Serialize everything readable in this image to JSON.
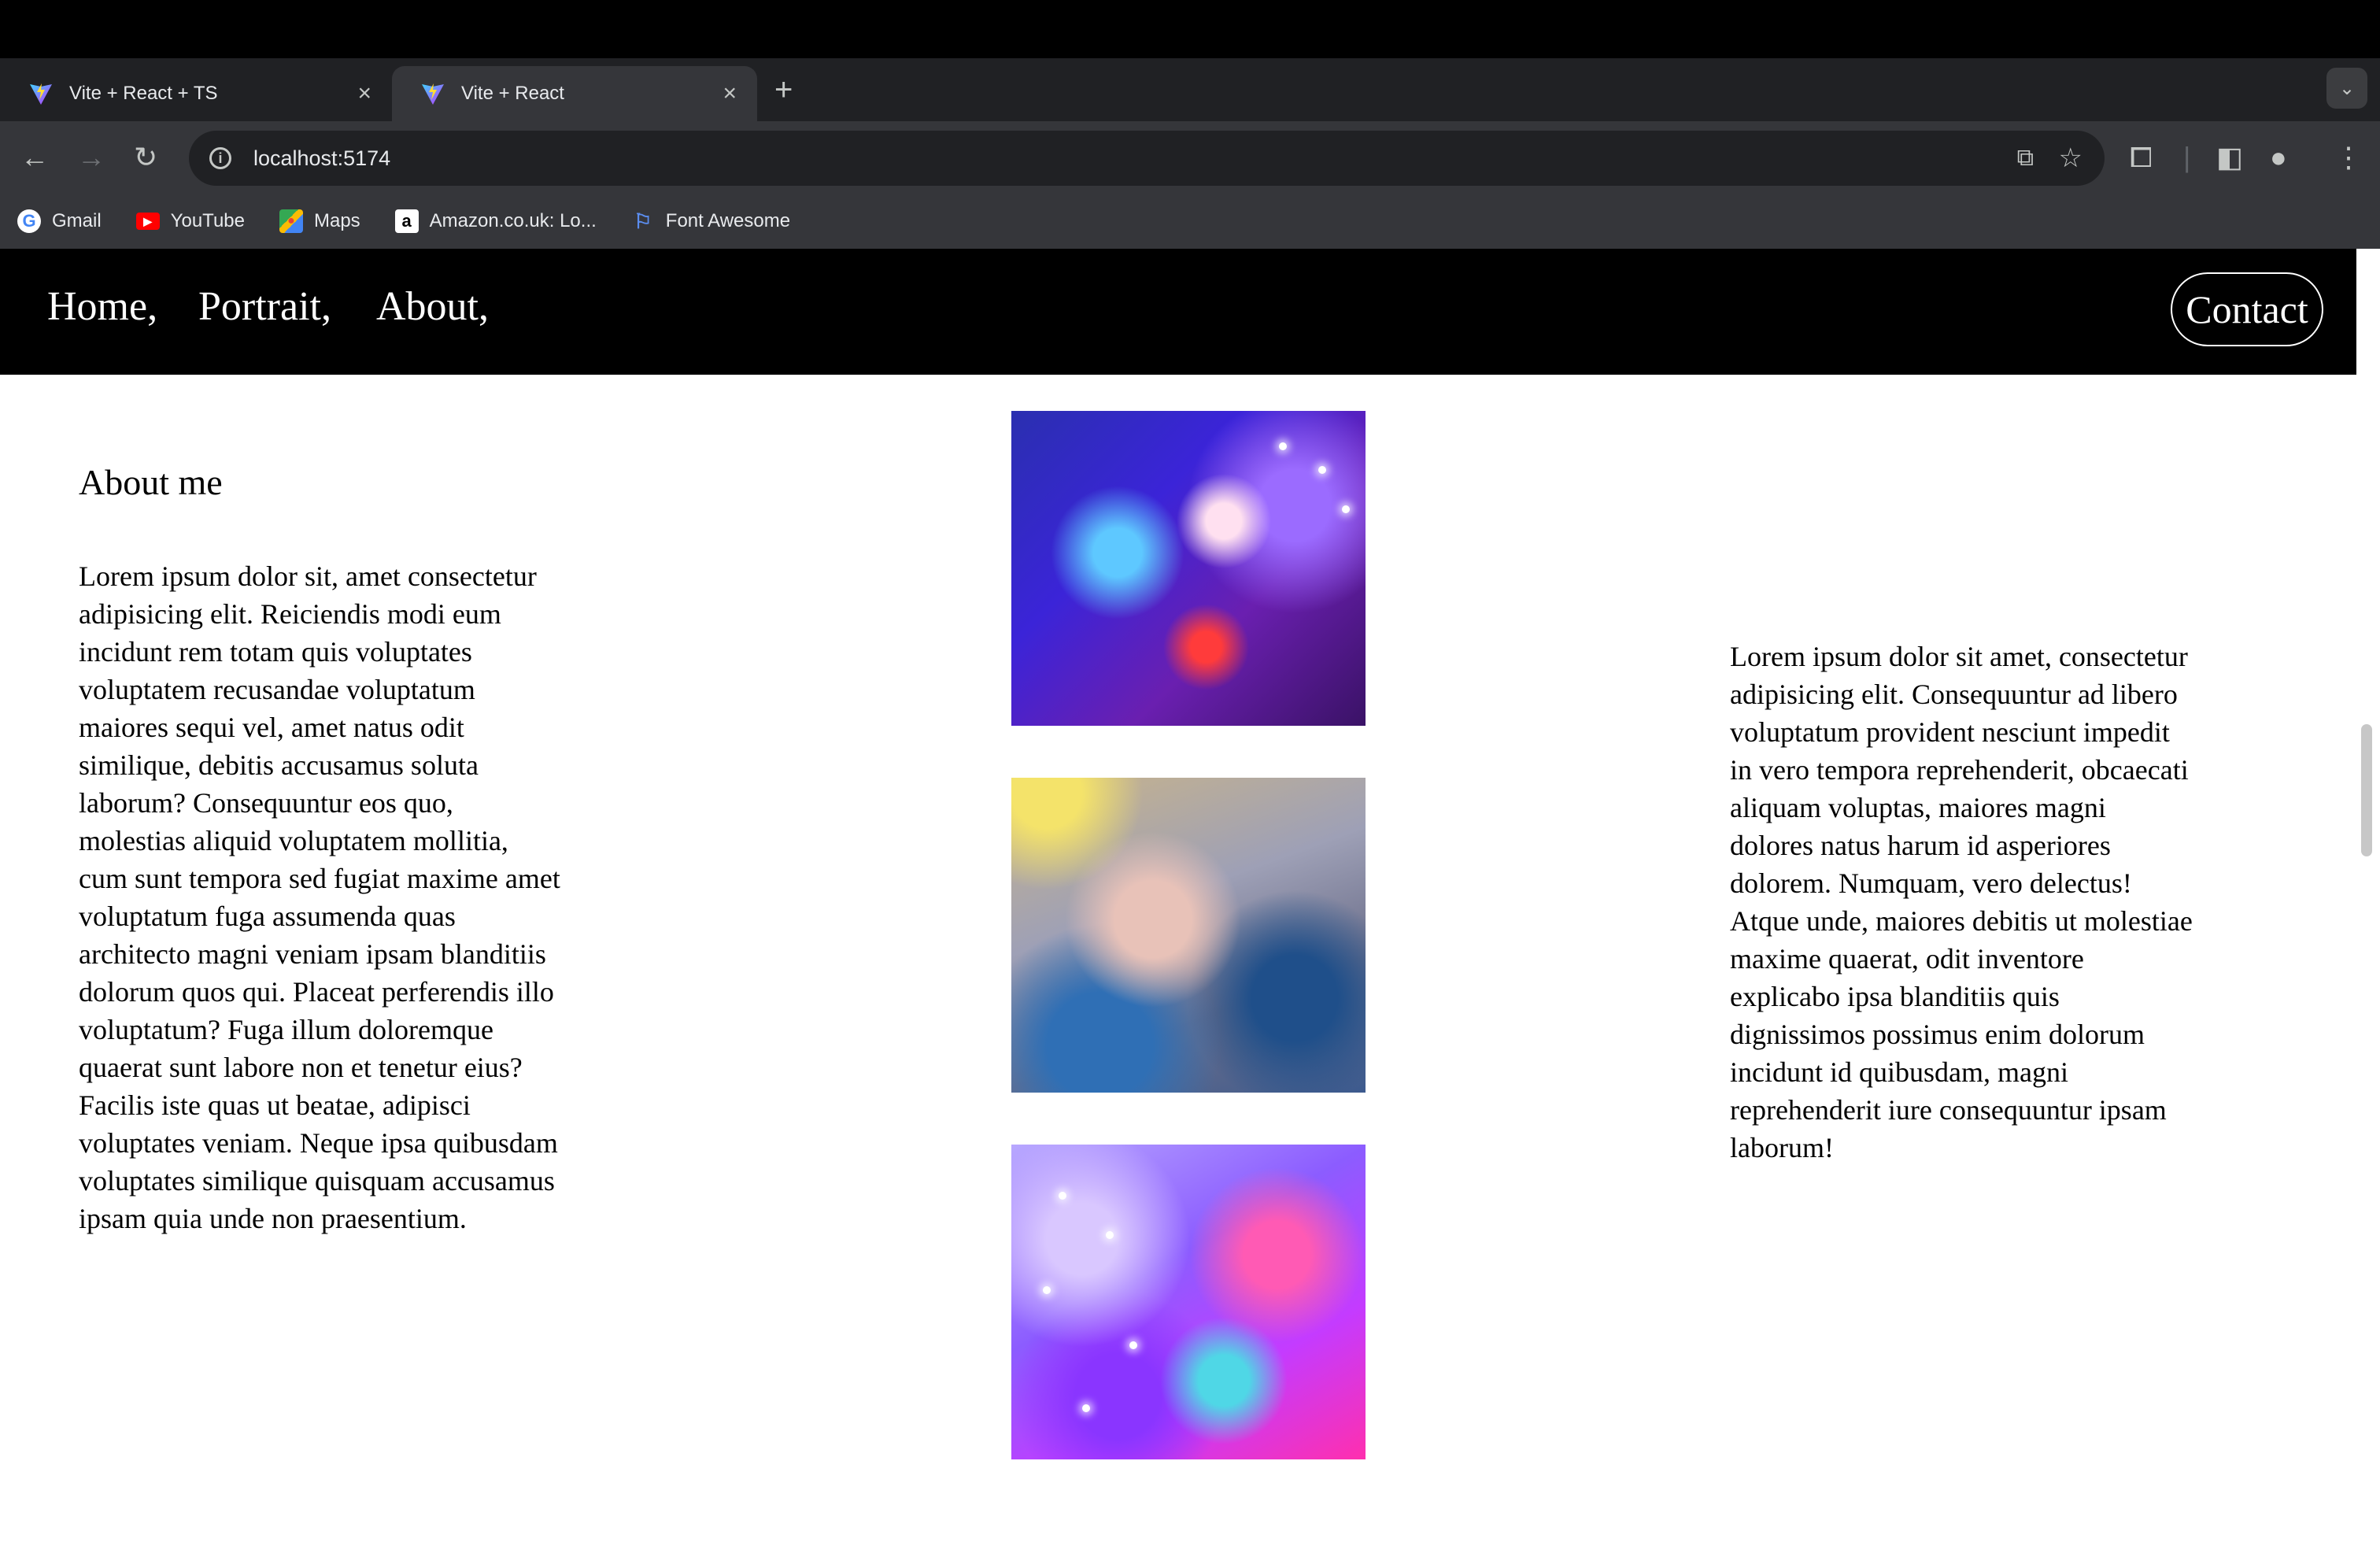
{
  "browser": {
    "tabs": [
      {
        "title": "Vite + React + TS",
        "active": false
      },
      {
        "title": "Vite + React",
        "active": true
      }
    ],
    "new_tab_symbol": "+",
    "close_symbol": "×",
    "url": "localhost:5174",
    "bookmarks": [
      {
        "label": "Gmail",
        "icon": "google-icon"
      },
      {
        "label": "YouTube",
        "icon": "youtube-icon"
      },
      {
        "label": "Maps",
        "icon": "maps-icon"
      },
      {
        "label": "Amazon.co.uk: Lo...",
        "icon": "amazon-icon"
      },
      {
        "label": "Font Awesome",
        "icon": "flag-icon"
      }
    ]
  },
  "site": {
    "nav": {
      "home": "Home,",
      "portrait": "Portrait,",
      "about": "About,",
      "contact": "Contact"
    },
    "about_title": "About me",
    "left_paragraph": "Lorem ipsum dolor sit, amet consectetur adipisicing elit. Reiciendis modi eum incidunt rem totam quis voluptates voluptatem recusandae voluptatum maiores sequi vel, amet natus odit similique, debitis accusamus soluta laborum? Consequuntur eos quo, molestias aliquid voluptatem mollitia, cum sunt tempora sed fugiat maxime amet voluptatum fuga assumenda quas architecto magni veniam ipsam blanditiis dolorum quos qui. Placeat perferendis illo voluptatum? Fuga illum doloremque quaerat sunt labore non et tenetur eius? Facilis iste quas ut beatae, adipisci voluptates veniam. Neque ipsa quibusdam voluptates similique quisquam accusamus ipsam quia unde non praesentium.",
    "right_paragraph": "Lorem ipsum dolor sit amet, consectetur adipisicing elit. Consequuntur ad libero voluptatum provident nesciunt impedit in vero tempora reprehenderit, obcaecati aliquam voluptas, maiores magni dolores natus harum id asperiores dolorem. Numquam, vero delectus! Atque unde, maiores debitis ut molestiae maxime quaerat, odit inventore explicabo ipsa blanditiis quis dignissimos possimus enim dolorum incidunt id quibusdam, magni reprehenderit iure consequuntur ipsam laborum!"
  },
  "colors": {
    "nav_bg": "#000000",
    "page_bg": "#ffffff",
    "chrome_dark": "#202124",
    "chrome_toolbar": "#35363a"
  }
}
